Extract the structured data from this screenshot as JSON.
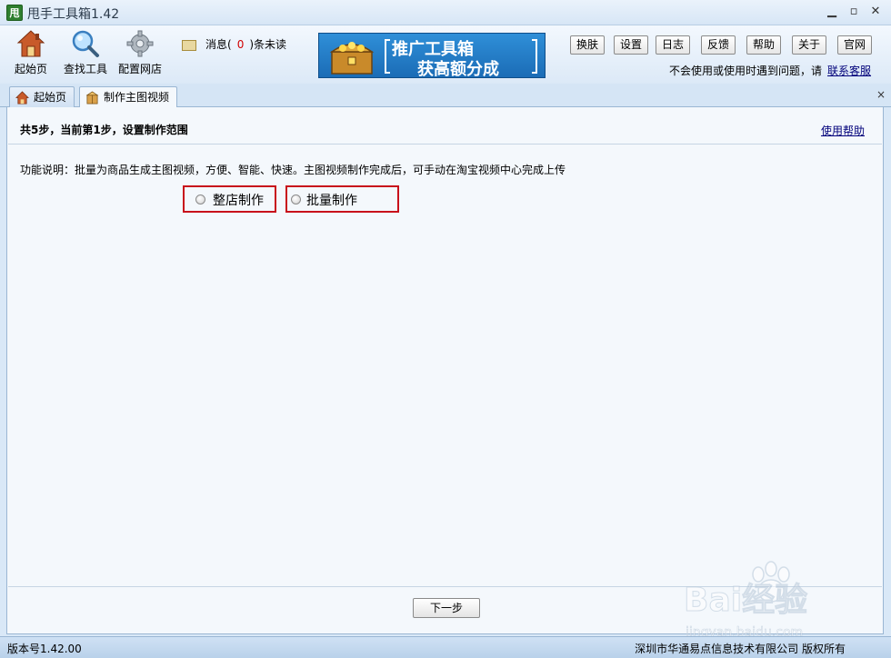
{
  "window": {
    "title": "甩手工具箱1.42",
    "icon_text": "甩",
    "minimize": "▁",
    "maximize": "▫",
    "close": "✕"
  },
  "toolbar": {
    "tools": [
      {
        "label": "起始页",
        "icon": "home-icon"
      },
      {
        "label": "查找工具",
        "icon": "search-icon"
      },
      {
        "label": "配置网店",
        "icon": "gear-icon"
      }
    ],
    "message": {
      "prefix": "消息(",
      "count": "0",
      "suffix": ")条未读"
    },
    "banner": {
      "line1": "推广工具箱",
      "line2": "获高额分成"
    },
    "buttons": [
      "换肤",
      "设置",
      "日志",
      "反馈",
      "帮助",
      "关于",
      "官网"
    ],
    "hint_text": "不会使用或使用时遇到问题，请",
    "hint_link": "联系客服"
  },
  "tabs": [
    {
      "label": "起始页",
      "icon": "home-icon",
      "active": false
    },
    {
      "label": "制作主图视频",
      "icon": "package-icon",
      "active": true
    }
  ],
  "tab_close": "×",
  "main": {
    "step_title": "共5步，当前第1步，设置制作范围",
    "help_link": "使用帮助",
    "description": "功能说明：批量为商品生成主图视频，方便、智能、快速。主图视频制作完成后，可手动在淘宝视频中心完成上传",
    "options": [
      "整店制作",
      "批量制作"
    ],
    "next_button": "下一步"
  },
  "status": {
    "version": "版本号1.42.00",
    "copyright": "深圳市华通易点信息技术有限公司 版权所有"
  },
  "watermark": {
    "text": "Bai经验",
    "url": "jingyan.baidu.com"
  },
  "colors": {
    "highlight_border": "#c8101b",
    "link": "#00007a",
    "message_count": "#d00000"
  }
}
